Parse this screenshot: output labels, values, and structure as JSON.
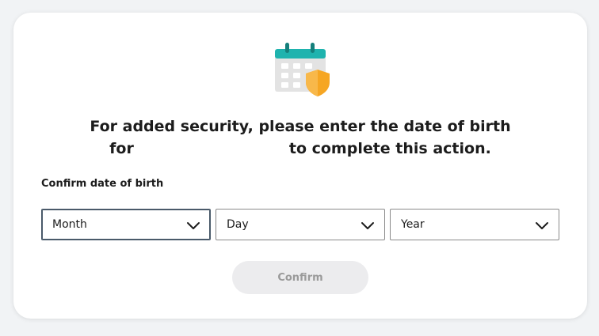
{
  "dialog": {
    "heading_line1": "For added security, please enter the date of birth",
    "heading_for": "for",
    "heading_line2_end": "to complete this action.",
    "field_label": "Confirm date of birth",
    "month_select": {
      "value": "Month"
    },
    "day_select": {
      "value": "Day"
    },
    "year_select": {
      "value": "Year"
    },
    "confirm_label": "Confirm"
  },
  "icons": {
    "header": "calendar-shield-icon",
    "dropdown": "chevron-down-icon"
  },
  "colors": {
    "calendar_teal": "#1fb3ae",
    "calendar_grid": "#d9d9d9",
    "shield_orange": "#f6a623",
    "button_disabled_bg": "#ececee",
    "button_disabled_text": "#9a9a9a"
  }
}
